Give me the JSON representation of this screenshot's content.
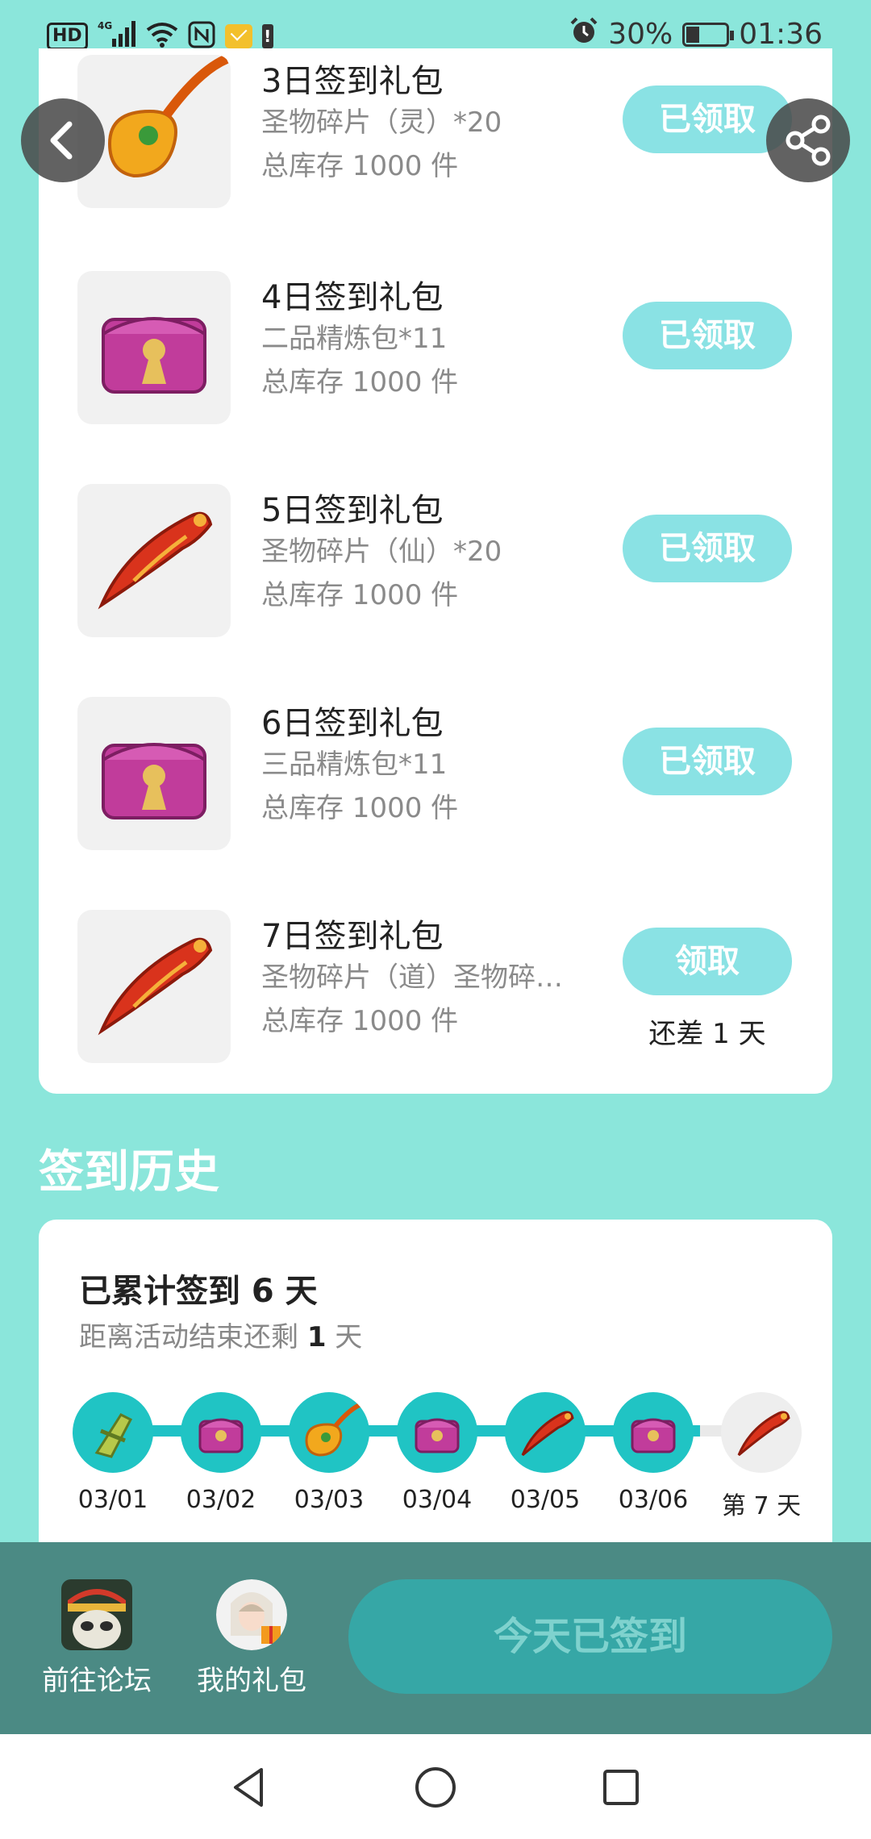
{
  "status_bar": {
    "hd_badge": "HD",
    "signal": "4G",
    "battery_percent": "30%",
    "time": "01:36"
  },
  "gifts": [
    {
      "title": "3日签到礼包",
      "item": "圣物碎片（灵）*20",
      "stock": "总库存 1000 件",
      "button": "已领取",
      "icon": "golden-amulet-icon"
    },
    {
      "title": "4日签到礼包",
      "item": "二品精炼包*11",
      "stock": "总库存 1000 件",
      "button": "已领取",
      "icon": "treasure-chest-icon"
    },
    {
      "title": "5日签到礼包",
      "item": "圣物碎片（仙）*20",
      "stock": "总库存 1000 件",
      "button": "已领取",
      "icon": "red-fragment-icon"
    },
    {
      "title": "6日签到礼包",
      "item": "三品精炼包*11",
      "stock": "总库存 1000 件",
      "button": "已领取",
      "icon": "treasure-chest-icon"
    },
    {
      "title": "7日签到礼包",
      "item": "圣物碎片（道）圣物碎…",
      "stock": "总库存 1000 件",
      "button": "领取",
      "note": "还差 1 天",
      "icon": "red-fragment-icon"
    }
  ],
  "history": {
    "heading": "签到历史",
    "total_label": "已累计签到 6 天",
    "remain_prefix": "距离活动结束还剩 ",
    "remain_value": "1",
    "remain_suffix": " 天",
    "days": [
      {
        "label": "03/01",
        "icon": "green-blade-icon",
        "done": true
      },
      {
        "label": "03/02",
        "icon": "treasure-chest-icon",
        "done": true
      },
      {
        "label": "03/03",
        "icon": "golden-amulet-icon",
        "done": true
      },
      {
        "label": "03/04",
        "icon": "treasure-chest-icon",
        "done": true
      },
      {
        "label": "03/05",
        "icon": "red-fragment-icon",
        "done": true
      },
      {
        "label": "03/06",
        "icon": "treasure-chest-icon",
        "done": true
      },
      {
        "label": "第 7 天",
        "icon": "red-fragment-icon",
        "done": false
      }
    ]
  },
  "bottom_bar": {
    "forum_label": "前往论坛",
    "gifts_label": "我的礼包",
    "checkin_label": "今天已签到"
  },
  "colors": {
    "background": "#8be6db",
    "accent": "#20c4c4",
    "claimed_button": "#8ae2e4",
    "bottom_bar": "#4b8a84"
  }
}
